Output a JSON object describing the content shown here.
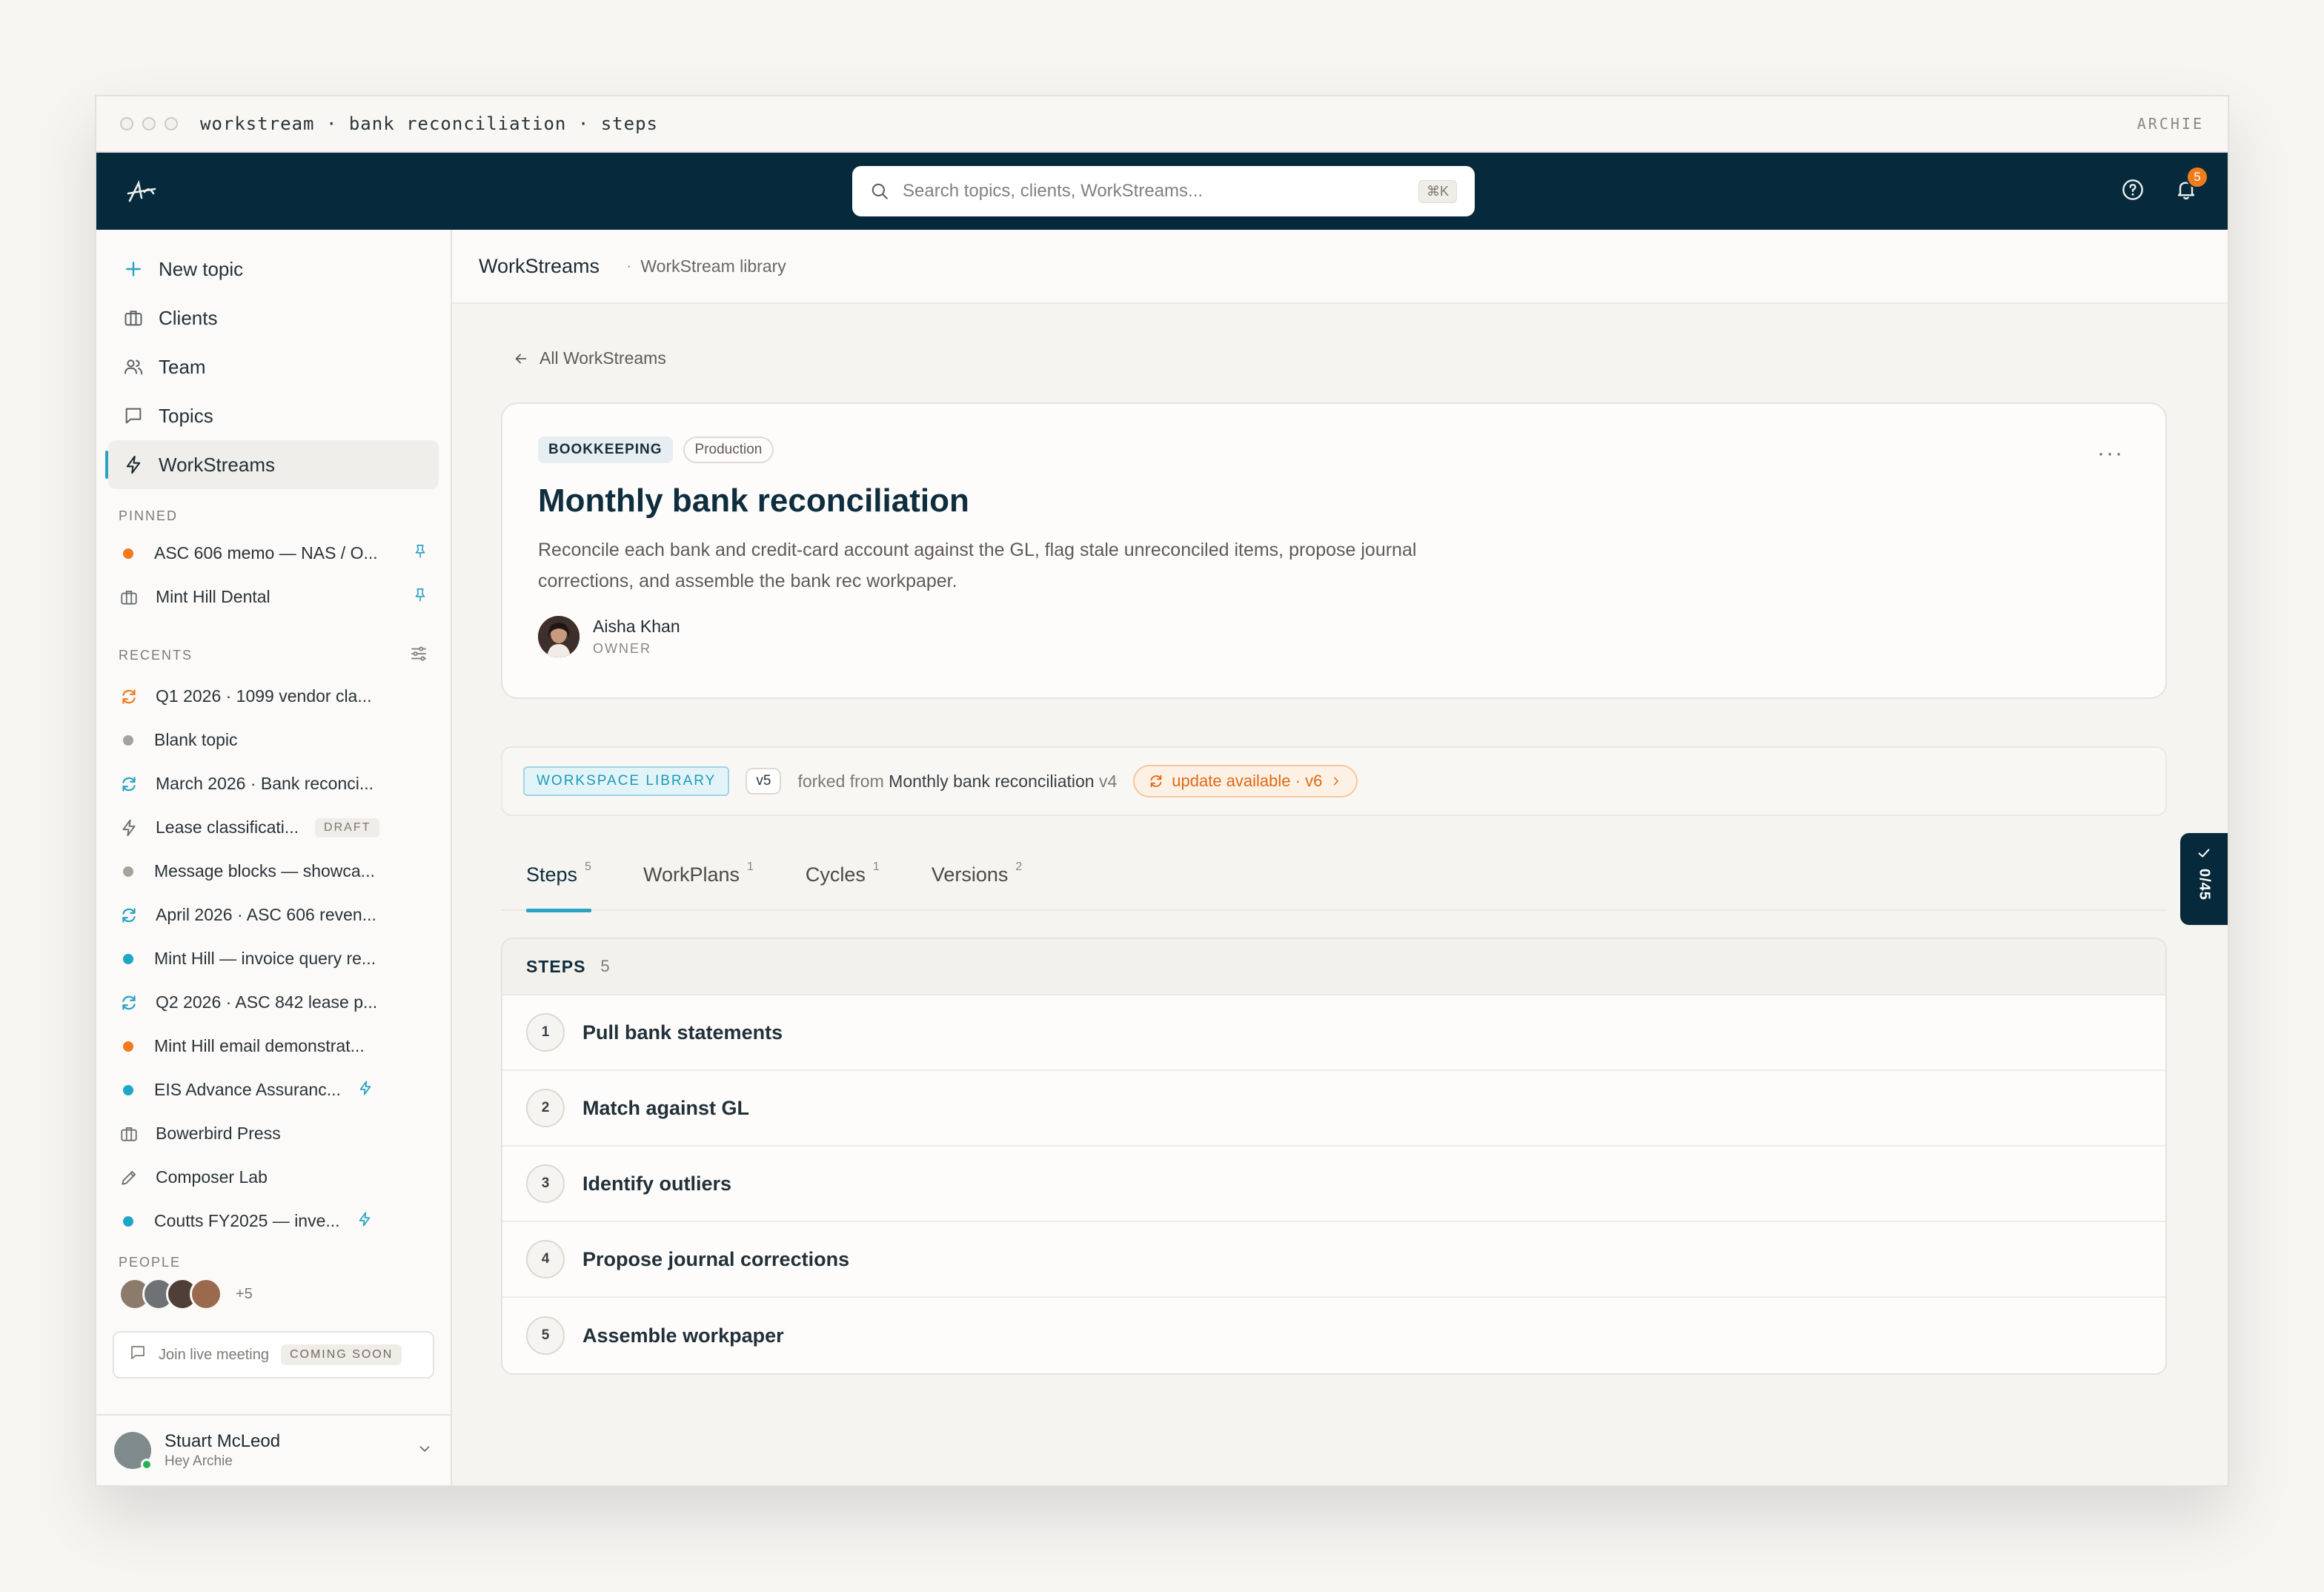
{
  "window": {
    "title": "workstream · bank reconciliation · steps",
    "user_tag": "ARCHIE"
  },
  "topnav": {
    "search_placeholder": "Search topics, clients, WorkStreams...",
    "search_shortcut": "⌘K",
    "notifications_count": "5"
  },
  "sidebar": {
    "nav": [
      {
        "label": "New topic",
        "icon": "plus-icon"
      },
      {
        "label": "Clients",
        "icon": "briefcase-icon"
      },
      {
        "label": "Team",
        "icon": "users-icon"
      },
      {
        "label": "Topics",
        "icon": "chat-bubble-icon"
      },
      {
        "label": "WorkStreams",
        "icon": "lightning-icon",
        "active": true
      }
    ],
    "pinned_label": "PINNED",
    "pinned": [
      {
        "label": "ASC 606 memo — NAS / O...",
        "icon": "dot",
        "color": "#f07b1d"
      },
      {
        "label": "Mint Hill Dental",
        "icon": "briefcase-icon"
      }
    ],
    "recents_label": "RECENTS",
    "recents": [
      {
        "label": "Q1 2026 · 1099 vendor cla...",
        "icon": "sync-icon",
        "color": "#f07b1d"
      },
      {
        "label": "Blank topic",
        "icon": "dot",
        "color": "#a7a39b"
      },
      {
        "label": "March 2026 · Bank reconci...",
        "icon": "sync-icon",
        "color": "#2aa3c2"
      },
      {
        "label": "Lease classificati...",
        "icon": "lightning-icon",
        "badge": "DRAFT"
      },
      {
        "label": "Message blocks — showca...",
        "icon": "dot",
        "color": "#a7a39b"
      },
      {
        "label": "April 2026 · ASC 606 reven...",
        "icon": "sync-icon",
        "color": "#2aa3c2"
      },
      {
        "label": "Mint Hill — invoice query re...",
        "icon": "dot",
        "color": "#1ea6c6"
      },
      {
        "label": "Q2 2026 · ASC 842 lease p...",
        "icon": "sync-icon",
        "color": "#2aa3c2"
      },
      {
        "label": "Mint Hill email demonstrat...",
        "icon": "dot",
        "color": "#f07b1d"
      },
      {
        "label": "EIS Advance Assuranc...",
        "icon": "dot",
        "color": "#1ea6c6",
        "trailing": "lightning-icon"
      },
      {
        "label": "Bowerbird Press",
        "icon": "briefcase-icon"
      },
      {
        "label": "Composer Lab",
        "icon": "pencil-icon"
      },
      {
        "label": "Coutts FY2025 — inve...",
        "icon": "dot",
        "color": "#1ea6c6",
        "trailing": "lightning-icon"
      }
    ],
    "people_label": "PEOPLE",
    "people_more": "+5",
    "meeting_label": "Join live meeting",
    "meeting_badge": "COMING SOON",
    "user": {
      "name": "Stuart McLeod",
      "subtitle": "Hey Archie"
    }
  },
  "crumbs": {
    "main": "WorkStreams",
    "sep": "·",
    "sub": "WorkStream library"
  },
  "back_label": "All WorkStreams",
  "workstream": {
    "tag_category": "BOOKKEEPING",
    "tag_status": "Production",
    "title": "Monthly bank reconciliation",
    "description": "Reconcile each bank and credit-card account against the GL, flag stale unreconciled items, propose journal corrections, and assemble the bank rec workpaper.",
    "owner_name": "Aisha Khan",
    "owner_role": "OWNER",
    "more": "···"
  },
  "library": {
    "tag": "WORKSPACE LIBRARY",
    "version": "v5",
    "forked_prefix": "forked from",
    "forked_name": "Monthly bank reconciliation",
    "forked_version": "v4",
    "update_label": "update available · v6"
  },
  "tabs": [
    {
      "label": "Steps",
      "count": "5",
      "active": true
    },
    {
      "label": "WorkPlans",
      "count": "1"
    },
    {
      "label": "Cycles",
      "count": "1"
    },
    {
      "label": "Versions",
      "count": "2"
    }
  ],
  "steps": {
    "header": "STEPS",
    "count": "5",
    "items": [
      {
        "num": "1",
        "title": "Pull bank statements"
      },
      {
        "num": "2",
        "title": "Match against GL"
      },
      {
        "num": "3",
        "title": "Identify outliers"
      },
      {
        "num": "4",
        "title": "Propose journal corrections"
      },
      {
        "num": "5",
        "title": "Assemble workpaper"
      }
    ]
  },
  "progress": {
    "value": "0/45"
  },
  "colors": {
    "nav_bg": "#062a3b",
    "accent": "#2aa3c2",
    "orange": "#f07b1d"
  }
}
